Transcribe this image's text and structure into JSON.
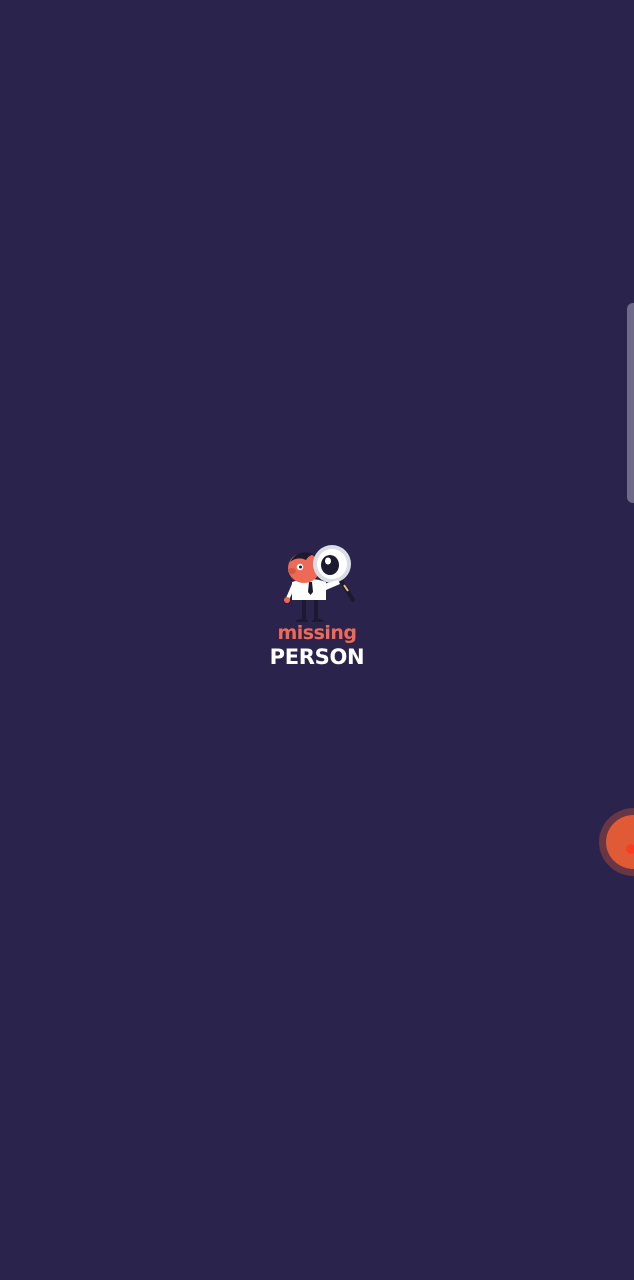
{
  "logo": {
    "line1": "missing",
    "line2": "PERSON",
    "icon": "detective-magnifier-icon"
  },
  "side_handle": {
    "icon": "edge-panel-handle"
  },
  "floating_bubble": {
    "icon": "record-dot-icon"
  },
  "colors": {
    "background": "#2a244d",
    "logo_accent": "#ef6a56",
    "logo_text": "#ffffff",
    "bubble": "#e05a36"
  }
}
